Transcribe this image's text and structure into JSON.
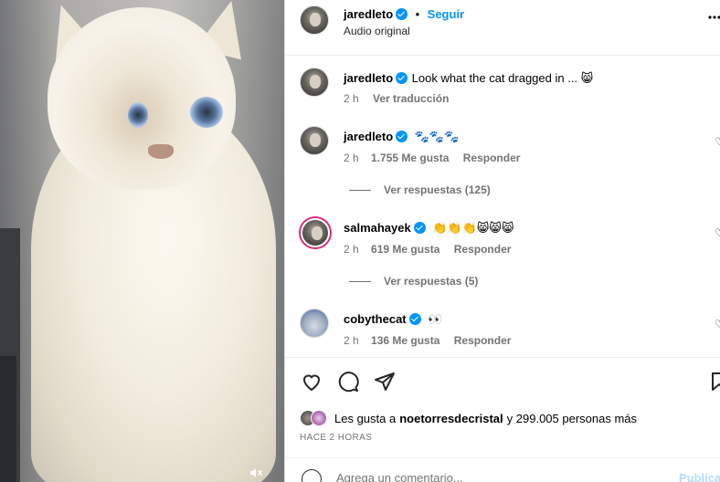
{
  "header": {
    "username": "jaredleto",
    "follow_label": "Seguir",
    "separator": "•",
    "audio": "Audio original",
    "more_icon": "more-options-icon"
  },
  "caption": {
    "username": "jaredleto",
    "text": "Look what the cat dragged in ... 😸",
    "time": "2 h",
    "translate": "Ver traducción"
  },
  "comments": [
    {
      "username": "jaredleto",
      "text": "🐾🐾🐾",
      "time": "2 h",
      "likes": "1.755 Me gusta",
      "reply": "Responder",
      "replies_label": "Ver respuestas (125)"
    },
    {
      "username": "salmahayek",
      "text": "👏👏👏😸😸😸",
      "time": "2 h",
      "likes": "619 Me gusta",
      "reply": "Responder",
      "replies_label": "Ver respuestas (5)"
    },
    {
      "username": "cobythecat",
      "text": "👀",
      "time": "2 h",
      "likes": "136 Me gusta",
      "reply": "Responder"
    }
  ],
  "footer": {
    "likes_prefix": "Les gusta a",
    "likes_user": "noetorresdecristal",
    "likes_suffix": "y 299.005 personas más",
    "time_ago": "HACE 2 HORAS",
    "comment_placeholder": "Agrega un comentario...",
    "publish_label": "Publicar"
  },
  "colors": {
    "accent": "#0095f6",
    "secondary_text": "#737373",
    "publish_disabled": "#b3dbfb"
  }
}
